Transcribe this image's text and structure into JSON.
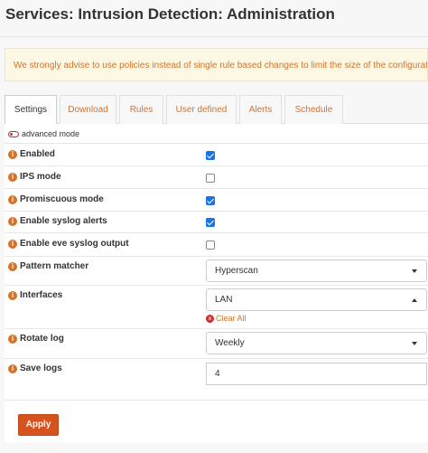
{
  "page": {
    "title": "Services: Intrusion Detection: Administration",
    "alert": "We strongly advise to use policies instead of single rule based changes to limit the size of the configuration."
  },
  "tabs": [
    {
      "label": "Settings",
      "active": true
    },
    {
      "label": "Download",
      "active": false
    },
    {
      "label": "Rules",
      "active": false
    },
    {
      "label": "User defined",
      "active": false
    },
    {
      "label": "Alerts",
      "active": false
    },
    {
      "label": "Schedule",
      "active": false
    }
  ],
  "settings": {
    "advanced_mode_label": "advanced mode",
    "enabled": {
      "label": "Enabled",
      "checked": true
    },
    "ips_mode": {
      "label": "IPS mode",
      "checked": false
    },
    "promiscuous_mode": {
      "label": "Promiscuous mode",
      "checked": true
    },
    "enable_syslog_alerts": {
      "label": "Enable syslog alerts",
      "checked": true
    },
    "enable_eve_syslog_output": {
      "label": "Enable eve syslog output",
      "checked": false
    },
    "pattern_matcher": {
      "label": "Pattern matcher",
      "value": "Hyperscan"
    },
    "interfaces": {
      "label": "Interfaces",
      "value": "LAN",
      "clear_label": "Clear All"
    },
    "rotate_log": {
      "label": "Rotate log",
      "value": "Weekly"
    },
    "save_logs": {
      "label": "Save logs",
      "value": "4"
    },
    "apply_label": "Apply"
  },
  "icons": {
    "info": "info-icon",
    "clear": "clear-icon",
    "toggle": "toggle-icon"
  },
  "colors": {
    "accent": "#d4722a",
    "apply": "#d4531e",
    "checkbox": "#1a73e8",
    "alert_bg": "#fcf8e3"
  }
}
